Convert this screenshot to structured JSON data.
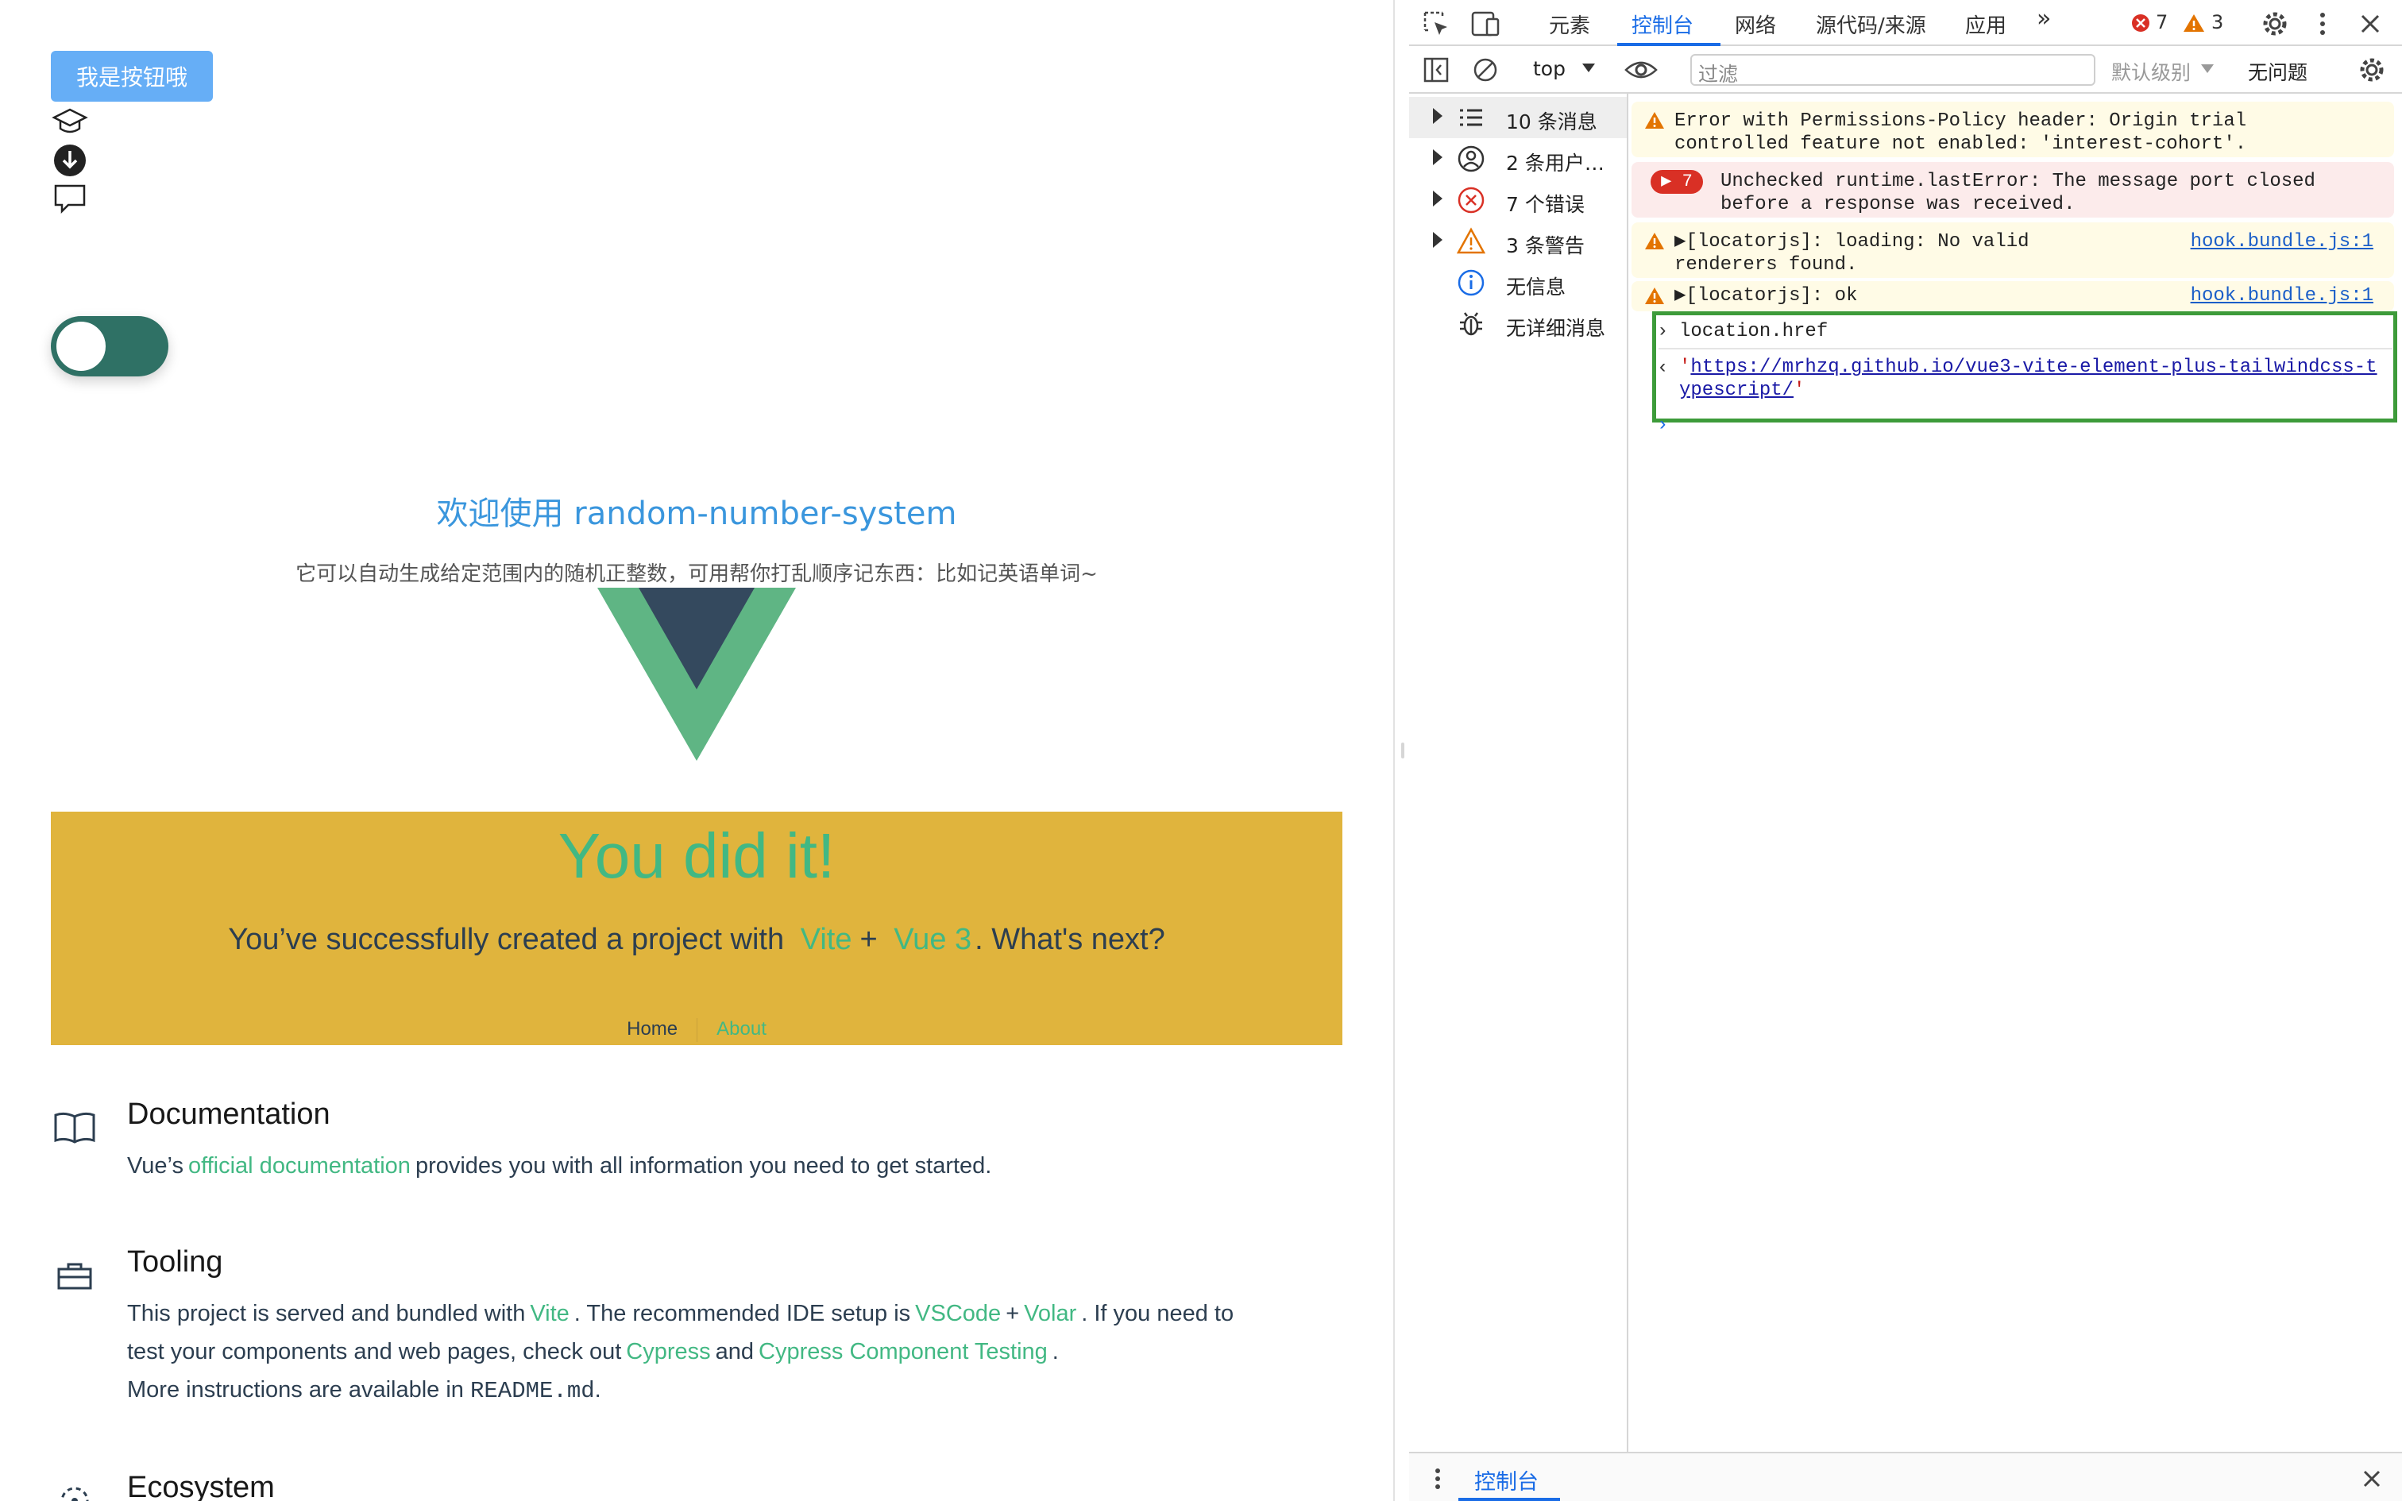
{
  "app": {
    "button_label": "我是按钮哦",
    "welcome": "欢迎使用 random-number-system",
    "description": "它可以自动生成给定范围内的随机正整数，可用帮你打乱顺序记东西：比如记英语单词~",
    "banner": {
      "title": "You did it!",
      "sub_prefix": "You’ve successfully created a project with",
      "vite": "Vite",
      "plus": "+",
      "vue3": "Vue 3",
      "sub_suffix": ". What's next?",
      "nav_home": "Home",
      "nav_about": "About"
    },
    "documentation": {
      "title": "Documentation",
      "pre": "Vue’s",
      "link": "official documentation",
      "post": "provides you with all information you need to get started."
    },
    "tooling": {
      "title": "Tooling",
      "t1": "This project is served and bundled with",
      "vite": "Vite",
      "t2": ". The recommended IDE setup is",
      "vscode": "VSCode",
      "plus": "+",
      "volar": "Volar",
      "t3": ". If you need to",
      "t4": "test your components and web pages, check out",
      "cypress": "Cypress",
      "and": "and",
      "cct": "Cypress Component Testing",
      "dot": ".",
      "t5": "More instructions are available in",
      "readme": "README.md",
      "t6": "."
    },
    "ecosystem": {
      "title": "Ecosystem"
    },
    "colors": {
      "accent_green": "#42b883",
      "banner": "#e0b43d",
      "toggle": "#2f7165",
      "button": "#66aef6"
    }
  },
  "devtools": {
    "tabs": [
      "元素",
      "控制台",
      "网络",
      "源代码/来源",
      "应用"
    ],
    "active_tab": "控制台",
    "more_tabs": "»",
    "error_count": "7",
    "warning_count": "3",
    "toolbar": {
      "context": "top",
      "filter_placeholder": "过滤",
      "level": "默认级别",
      "issues": "无问题"
    },
    "sidebar": [
      {
        "label": "10 条消息",
        "icon": "list-icon"
      },
      {
        "label": "2 条用户…",
        "icon": "user-icon"
      },
      {
        "label": "7 个错误",
        "icon": "error-icon"
      },
      {
        "label": "3 条警告",
        "icon": "warning-icon"
      },
      {
        "label": "无信息",
        "icon": "info-icon"
      },
      {
        "label": "无详细消息",
        "icon": "bug-icon"
      }
    ],
    "messages": [
      {
        "type": "warning",
        "line1": "Error with Permissions-Policy header: Origin trial",
        "line2": "controlled feature not enabled: 'interest-cohort'."
      },
      {
        "type": "error",
        "count": "7",
        "line1": "Unchecked runtime.lastError: The message port closed",
        "line2": "before a response was received."
      },
      {
        "type": "warning",
        "line1": "▶[locatorjs]: loading: No valid",
        "line2": "renderers found.",
        "source": "hook.bundle.js:1"
      },
      {
        "type": "warning",
        "line1": "▶[locatorjs]: ok",
        "source": "hook.bundle.js:1"
      }
    ],
    "input": "location.href",
    "output_url_line1": "https://mrhzq.github.io/vue3-vite-element-plus-tailwindcs",
    "output_url_line2": "s-typescript/",
    "quote": "'",
    "drawer_tab": "控制台"
  }
}
